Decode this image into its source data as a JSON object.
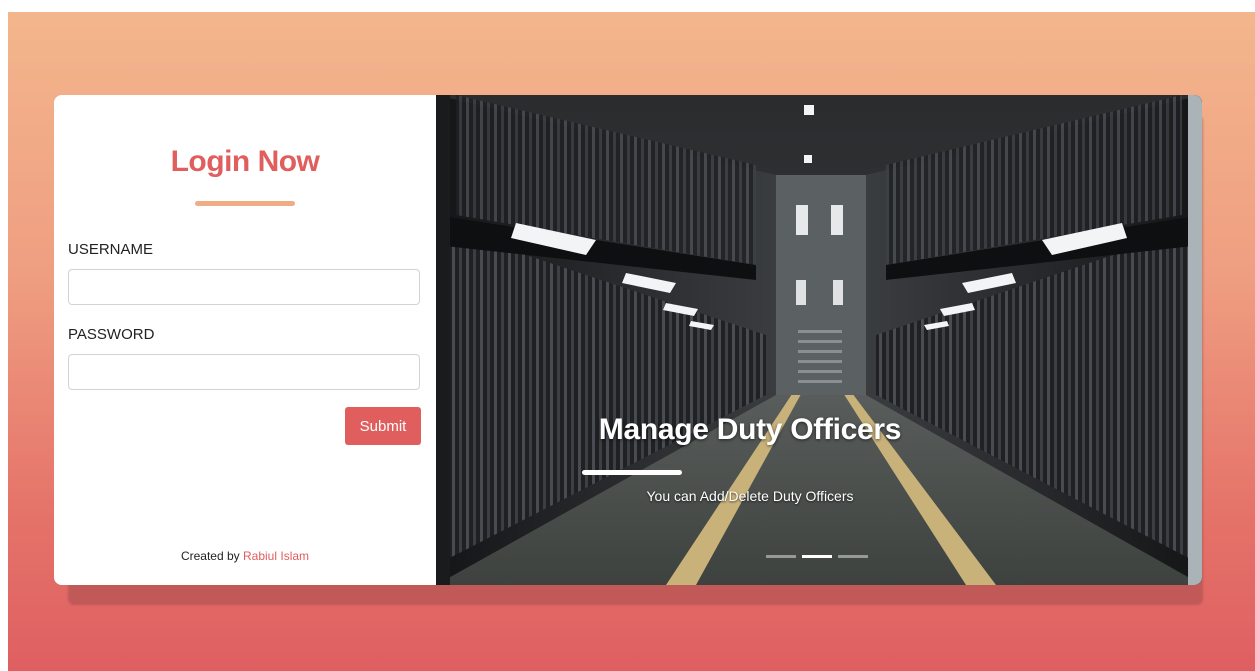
{
  "login": {
    "title": "Login Now",
    "username_label": "USERNAME",
    "username_value": "",
    "password_label": "PASSWORD",
    "password_value": "",
    "submit_label": "Submit"
  },
  "footer": {
    "prefix": "Created by ",
    "author": "Rabiul Islam"
  },
  "carousel": {
    "slide_title": "Manage Duty Officers",
    "slide_text": "You can Add/Delete Duty Officers",
    "indicator_count": 3,
    "active_index": 1
  },
  "colors": {
    "accent": "#e05e5e",
    "underline": "#f0ac85",
    "gradient_top": "#f3b68c",
    "gradient_bottom": "#df5f61"
  }
}
